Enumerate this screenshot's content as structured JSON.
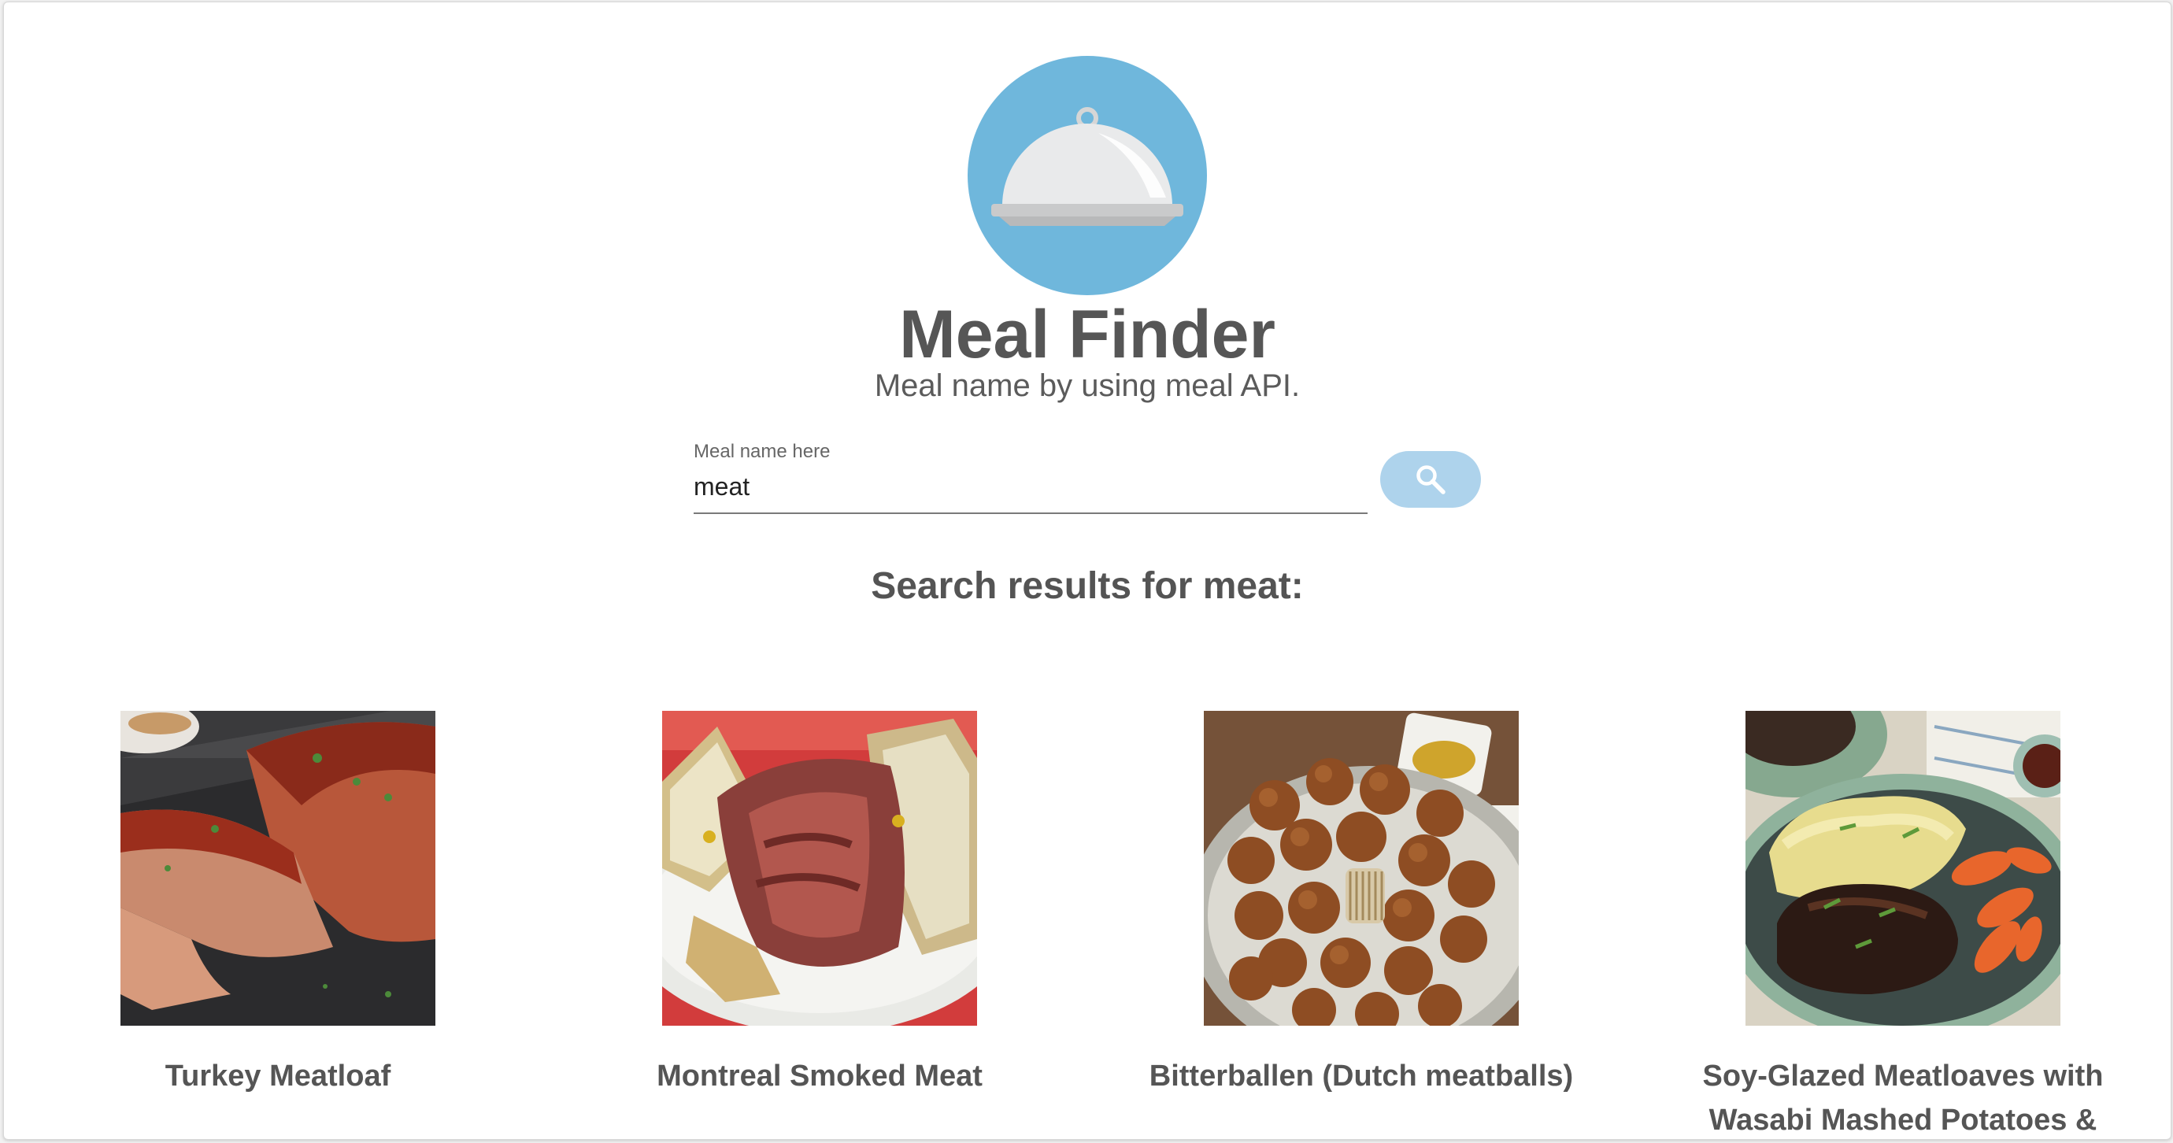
{
  "app": {
    "title": "Meal Finder",
    "subtitle": "Meal name by using meal API."
  },
  "search": {
    "label": "Meal name here",
    "value": "meat",
    "button_icon": "search-icon"
  },
  "results": {
    "heading": "Search results for meat:",
    "meals": [
      {
        "name": "Turkey Meatloaf",
        "image": "turkey-meatloaf-photo"
      },
      {
        "name": "Montreal Smoked Meat",
        "image": "montreal-smoked-meat-photo"
      },
      {
        "name": "Bitterballen (Dutch meatballs)",
        "image": "bitterballen-photo"
      },
      {
        "name": "Soy-Glazed Meatloaves with Wasabi Mashed Potatoes & Roasted Carrots",
        "image": "soy-glazed-meatloaves-photo"
      }
    ]
  },
  "colors": {
    "logo_circle": "#6fb7dc",
    "button_bg": "#aed3ec",
    "text_dark": "#555555"
  }
}
